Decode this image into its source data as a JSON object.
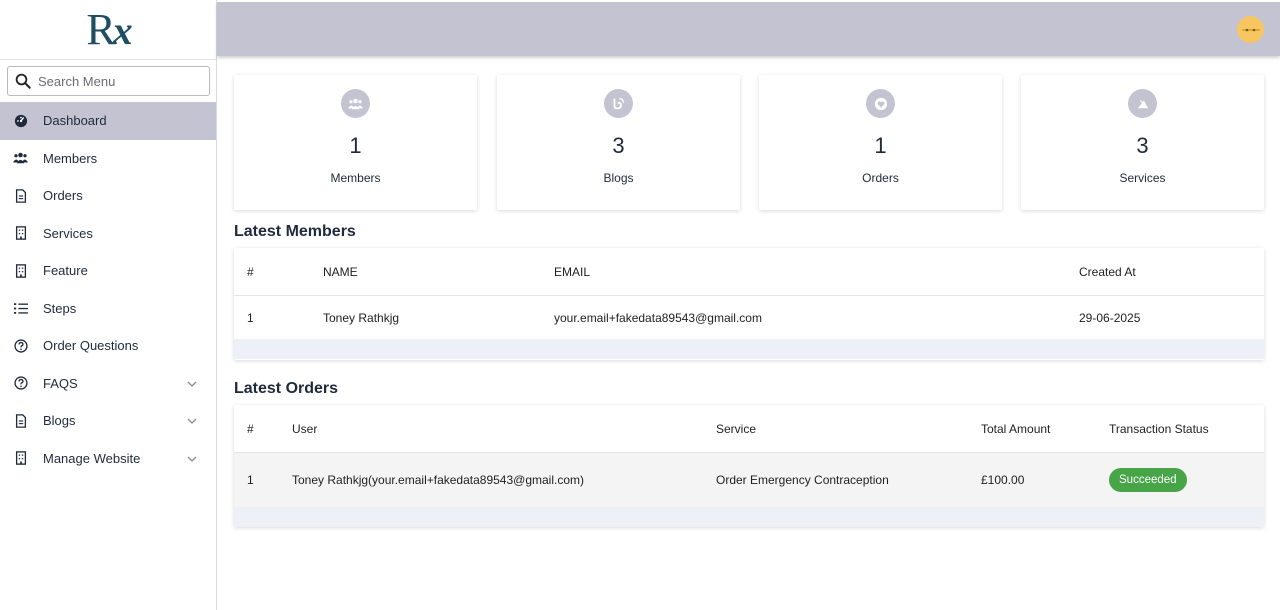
{
  "brand": {
    "logo_r": "R",
    "logo_x": "x"
  },
  "search": {
    "placeholder": "Search Menu"
  },
  "sidebar": {
    "items": [
      {
        "label": "Dashboard",
        "icon": "dashboard-gauge-icon",
        "active": true
      },
      {
        "label": "Members",
        "icon": "users-icon"
      },
      {
        "label": "Orders",
        "icon": "document-icon"
      },
      {
        "label": "Services",
        "icon": "building-icon"
      },
      {
        "label": "Feature",
        "icon": "building-icon"
      },
      {
        "label": "Steps",
        "icon": "list-icon"
      },
      {
        "label": "Order Questions",
        "icon": "question-circle-icon"
      },
      {
        "label": "FAQS",
        "icon": "question-circle-icon",
        "expandable": true
      },
      {
        "label": "Blogs",
        "icon": "document-icon",
        "expandable": true
      },
      {
        "label": "Manage Website",
        "icon": "building-icon",
        "expandable": true
      }
    ]
  },
  "stats": [
    {
      "value": "1",
      "label": "Members",
      "icon": "users-icon"
    },
    {
      "value": "3",
      "label": "Blogs",
      "icon": "blog-icon"
    },
    {
      "value": "1",
      "label": "Orders",
      "icon": "heart-badge-icon"
    },
    {
      "value": "3",
      "label": "Services",
      "icon": "service-icon"
    }
  ],
  "latest_members": {
    "title": "Latest Members",
    "headers": [
      "#",
      "NAME",
      "EMAIL",
      "Created At"
    ],
    "rows": [
      {
        "num": "1",
        "name": "Toney Rathkjg",
        "email": "your.email+fakedata89543@gmail.com",
        "created": "29-06-2025"
      }
    ]
  },
  "latest_orders": {
    "title": "Latest Orders",
    "headers": [
      "#",
      "User",
      "Service",
      "Total Amount",
      "Transaction Status"
    ],
    "rows": [
      {
        "num": "1",
        "user": "Toney Rathkjg(your.email+fakedata89543@gmail.com)",
        "service": "Order Emergency Contraception",
        "amount": "£100.00",
        "status": "Succeeded"
      }
    ]
  },
  "colors": {
    "accent": "#c4c3d1",
    "logo": "#1f4e63",
    "success": "#47a447",
    "avatar": "#f7c660"
  }
}
